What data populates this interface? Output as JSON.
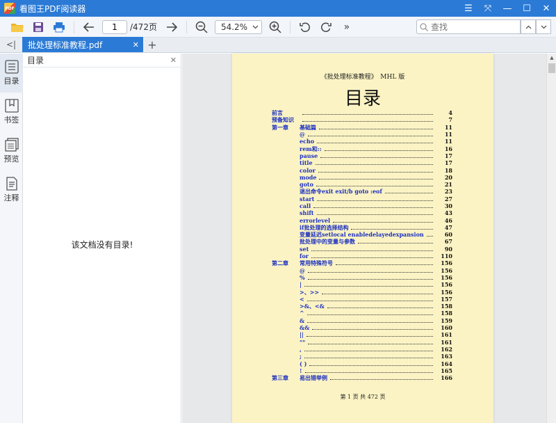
{
  "app": {
    "title": "看图王PDF阅读器",
    "icon_text": "PDF"
  },
  "window_controls": {
    "menu": "☰",
    "fullscreen": "⤧",
    "minimize": "—",
    "maximize": "☐",
    "close": "✕"
  },
  "toolbar": {
    "page_current": "1",
    "page_total": "/472页",
    "zoom": "54.2%",
    "more": "»",
    "search_placeholder": "查找"
  },
  "tabs": {
    "collapse": "<|",
    "active_tab": "批处理标准教程.pdf",
    "close": "✕",
    "new_tab": "+"
  },
  "left_nav": [
    {
      "label": "目录",
      "icon": "list-icon"
    },
    {
      "label": "书签",
      "icon": "bookmark-icon"
    },
    {
      "label": "预览",
      "icon": "pages-icon"
    },
    {
      "label": "注释",
      "icon": "note-icon"
    }
  ],
  "toc_panel": {
    "title": "目录",
    "close": "✕",
    "empty_message": "该文档没有目录!"
  },
  "document": {
    "header": "《批处理标准教程》　MHL 版",
    "title": "目录",
    "footer": "第 1 页 共 472 页",
    "entries": [
      {
        "chapter": "前言",
        "text": "",
        "page": "4"
      },
      {
        "chapter": "预备知识",
        "text": "",
        "page": "7"
      },
      {
        "chapter": "第一章",
        "text": "基础篇",
        "page": "11"
      },
      {
        "chapter": "",
        "text": "@",
        "page": "11"
      },
      {
        "chapter": "",
        "text": "echo",
        "page": "11"
      },
      {
        "chapter": "",
        "text": "rem和::",
        "page": "16"
      },
      {
        "chapter": "",
        "text": "pause",
        "page": "17"
      },
      {
        "chapter": "",
        "text": "title",
        "page": "17"
      },
      {
        "chapter": "",
        "text": "color",
        "page": "18"
      },
      {
        "chapter": "",
        "text": "mode",
        "page": "20"
      },
      {
        "chapter": "",
        "text": "goto",
        "page": "21"
      },
      {
        "chapter": "",
        "text": "退出命令exit exit/b goto :eof",
        "page": "23"
      },
      {
        "chapter": "",
        "text": "start",
        "page": "27"
      },
      {
        "chapter": "",
        "text": "call",
        "page": "30"
      },
      {
        "chapter": "",
        "text": "shift",
        "page": "43"
      },
      {
        "chapter": "",
        "text": "errorlevel",
        "page": "46"
      },
      {
        "chapter": "",
        "text": "if批处理的选择结构",
        "page": "47"
      },
      {
        "chapter": "",
        "text": "变量延迟setlocal enabledelayedexpansion",
        "page": "60"
      },
      {
        "chapter": "",
        "text": "批处理中的变量与参数",
        "page": "67"
      },
      {
        "chapter": "",
        "text": "set",
        "page": "90"
      },
      {
        "chapter": "",
        "text": "for",
        "page": "110"
      },
      {
        "chapter": "第二章",
        "text": "常用特殊符号",
        "page": "156"
      },
      {
        "chapter": "",
        "text": "@",
        "page": "156"
      },
      {
        "chapter": "",
        "text": "%",
        "page": "156"
      },
      {
        "chapter": "",
        "text": "|",
        "page": "156"
      },
      {
        "chapter": "",
        "text": ">、>>",
        "page": "156"
      },
      {
        "chapter": "",
        "text": "<",
        "page": "157"
      },
      {
        "chapter": "",
        "text": ">&、<&",
        "page": "158"
      },
      {
        "chapter": "",
        "text": "^",
        "page": "158"
      },
      {
        "chapter": "",
        "text": "&",
        "page": "159"
      },
      {
        "chapter": "",
        "text": "&&",
        "page": "160"
      },
      {
        "chapter": "",
        "text": "||",
        "page": "161"
      },
      {
        "chapter": "",
        "text": "\"\"",
        "page": "161"
      },
      {
        "chapter": "",
        "text": ",",
        "page": "162"
      },
      {
        "chapter": "",
        "text": ";",
        "page": "163"
      },
      {
        "chapter": "",
        "text": "( )",
        "page": "164"
      },
      {
        "chapter": "",
        "text": "!",
        "page": "165"
      },
      {
        "chapter": "第三章",
        "text": "易出错举例",
        "page": "166"
      }
    ]
  },
  "colors": {
    "accent": "#2b7bd6",
    "page_bg": "#fbf3c4",
    "toc_link": "#1a2fc1"
  }
}
